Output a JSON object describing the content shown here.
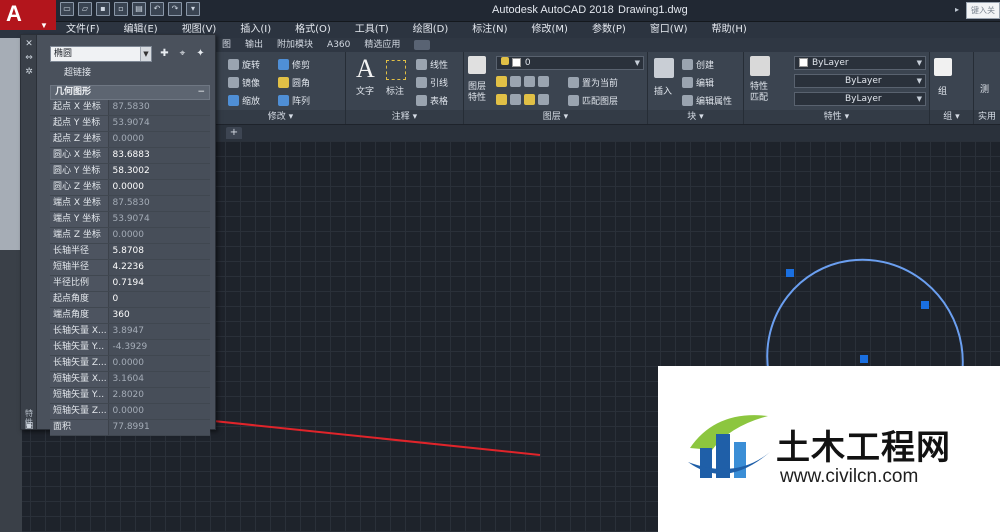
{
  "titlebar": {
    "app_logo": "A",
    "app_title": "Autodesk AutoCAD 2018",
    "file_title": "Drawing1.dwg",
    "search_placeholder": "键入关"
  },
  "menu": [
    "文件(F)",
    "编辑(E)",
    "视图(V)",
    "插入(I)",
    "格式(O)",
    "工具(T)",
    "绘图(D)",
    "标注(N)",
    "修改(M)",
    "参数(P)",
    "窗口(W)",
    "帮助(H)"
  ],
  "ribbon_tabs": [
    "图",
    "输出",
    "附加模块",
    "A360",
    "精选应用"
  ],
  "ribbon": {
    "modify": {
      "title": "修改 ▾",
      "rotate": "旋转",
      "trim": "修剪",
      "mirror": "镜像",
      "fillet": "圆角",
      "scale": "缩放",
      "array": "阵列"
    },
    "annotation": {
      "title": "注释 ▾",
      "text": "文字",
      "dimension": "标注",
      "linear": "线性",
      "leader": "引线",
      "table": "表格"
    },
    "layers": {
      "title": "图层 ▾",
      "layer_props_line1": "图层",
      "layer_props_line2": "特性",
      "layer_value": "0",
      "set_current": "置为当前",
      "match_layer": "匹配图层"
    },
    "block": {
      "title": "块 ▾",
      "insert": "插入",
      "create": "创建",
      "edit": "编辑",
      "edit_attr": "编辑属性"
    },
    "properties": {
      "title": "特性 ▾",
      "match_line1": "特性",
      "match_line2": "匹配",
      "color": "ByLayer",
      "linetype": "ByLayer",
      "lineweight": "ByLayer"
    },
    "group": {
      "title": "组 ▾",
      "group": "组"
    },
    "utilities": {
      "title": "实用",
      "measure": "测"
    }
  },
  "palette": {
    "object_type": "椭圆",
    "hyperlink_label": "超链接",
    "section_title": "几何图形",
    "side_label": "特性",
    "properties": [
      {
        "k": "起点 X 坐标",
        "v": "87.5830",
        "editable": false
      },
      {
        "k": "起点 Y 坐标",
        "v": "53.9074",
        "editable": false
      },
      {
        "k": "起点 Z 坐标",
        "v": "0.0000",
        "editable": false
      },
      {
        "k": "圆心 X 坐标",
        "v": "83.6883",
        "editable": true
      },
      {
        "k": "圆心 Y 坐标",
        "v": "58.3002",
        "editable": true
      },
      {
        "k": "圆心 Z 坐标",
        "v": "0.0000",
        "editable": true
      },
      {
        "k": "端点 X 坐标",
        "v": "87.5830",
        "editable": false
      },
      {
        "k": "端点 Y 坐标",
        "v": "53.9074",
        "editable": false
      },
      {
        "k": "端点 Z 坐标",
        "v": "0.0000",
        "editable": false
      },
      {
        "k": "长轴半径",
        "v": "5.8708",
        "editable": true
      },
      {
        "k": "短轴半径",
        "v": "4.2236",
        "editable": true
      },
      {
        "k": "半径比例",
        "v": "0.7194",
        "editable": true
      },
      {
        "k": "起点角度",
        "v": "0",
        "editable": true
      },
      {
        "k": "端点角度",
        "v": "360",
        "editable": true
      },
      {
        "k": "长轴矢量 X...",
        "v": "3.8947",
        "editable": false
      },
      {
        "k": "长轴矢量 Y...",
        "v": "-4.3929",
        "editable": false
      },
      {
        "k": "长轴矢量 Z...",
        "v": "0.0000",
        "editable": false
      },
      {
        "k": "短轴矢量 X...",
        "v": "3.1604",
        "editable": false
      },
      {
        "k": "短轴矢量 Y...",
        "v": "2.8020",
        "editable": false
      },
      {
        "k": "短轴矢量 Z...",
        "v": "0.0000",
        "editable": false
      },
      {
        "k": "面积",
        "v": "77.8991",
        "editable": false
      }
    ]
  },
  "colors": {
    "ellipse": "#6b9ff0",
    "grip": "#1a6fe0",
    "arrow": "#e0242a"
  },
  "watermark": {
    "cn": "土木工程网",
    "url": "www.civilcn.com"
  }
}
